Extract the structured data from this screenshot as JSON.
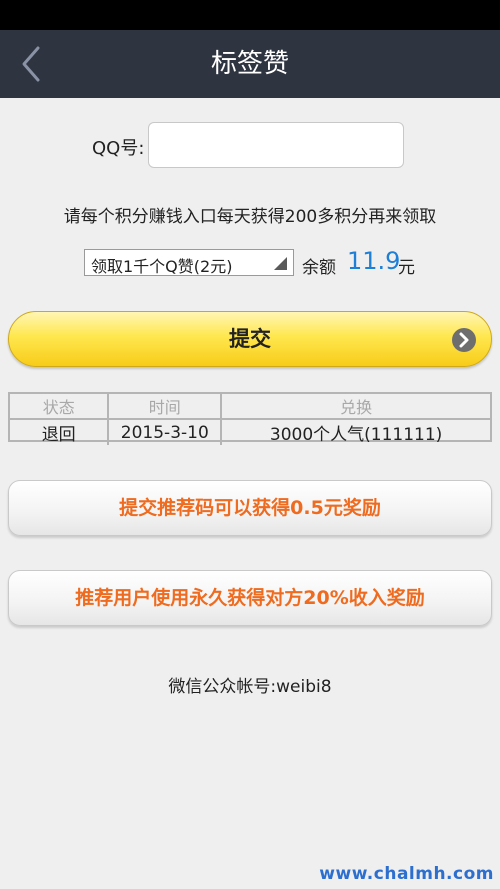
{
  "header": {
    "title": "标签赞",
    "back_icon": "chevron-left-icon"
  },
  "form": {
    "qq_label": "QQ号:",
    "qq_value": "",
    "qq_placeholder": "",
    "hint": "请每个积分赚钱入口每天获得200多积分再来领取",
    "select_value": "领取1千个Q赞(2元)",
    "balance_label": "余额",
    "balance_value": "11.9",
    "balance_unit": "元",
    "submit_label": "提交",
    "submit_icon": "arrow-right-circle-icon"
  },
  "records": {
    "headers": [
      "状态",
      "时间",
      "兑换"
    ],
    "rows": [
      [
        "退回",
        "2015-3-10",
        "3000个人气(111111)"
      ]
    ]
  },
  "promos": {
    "referral_code": "提交推荐码可以获得0.5元奖励",
    "referral_user": "推荐用户使用永久获得对方20%收入奖励"
  },
  "footer": {
    "wechat": "微信公众帐号:weibi8",
    "watermark": "www.chalmh.com"
  },
  "colors": {
    "nav_bg": "#2f3441",
    "accent_blue": "#1e7fd6",
    "promo_orange": "#ee6b1f",
    "submit_yellow": "#ffe74f"
  }
}
